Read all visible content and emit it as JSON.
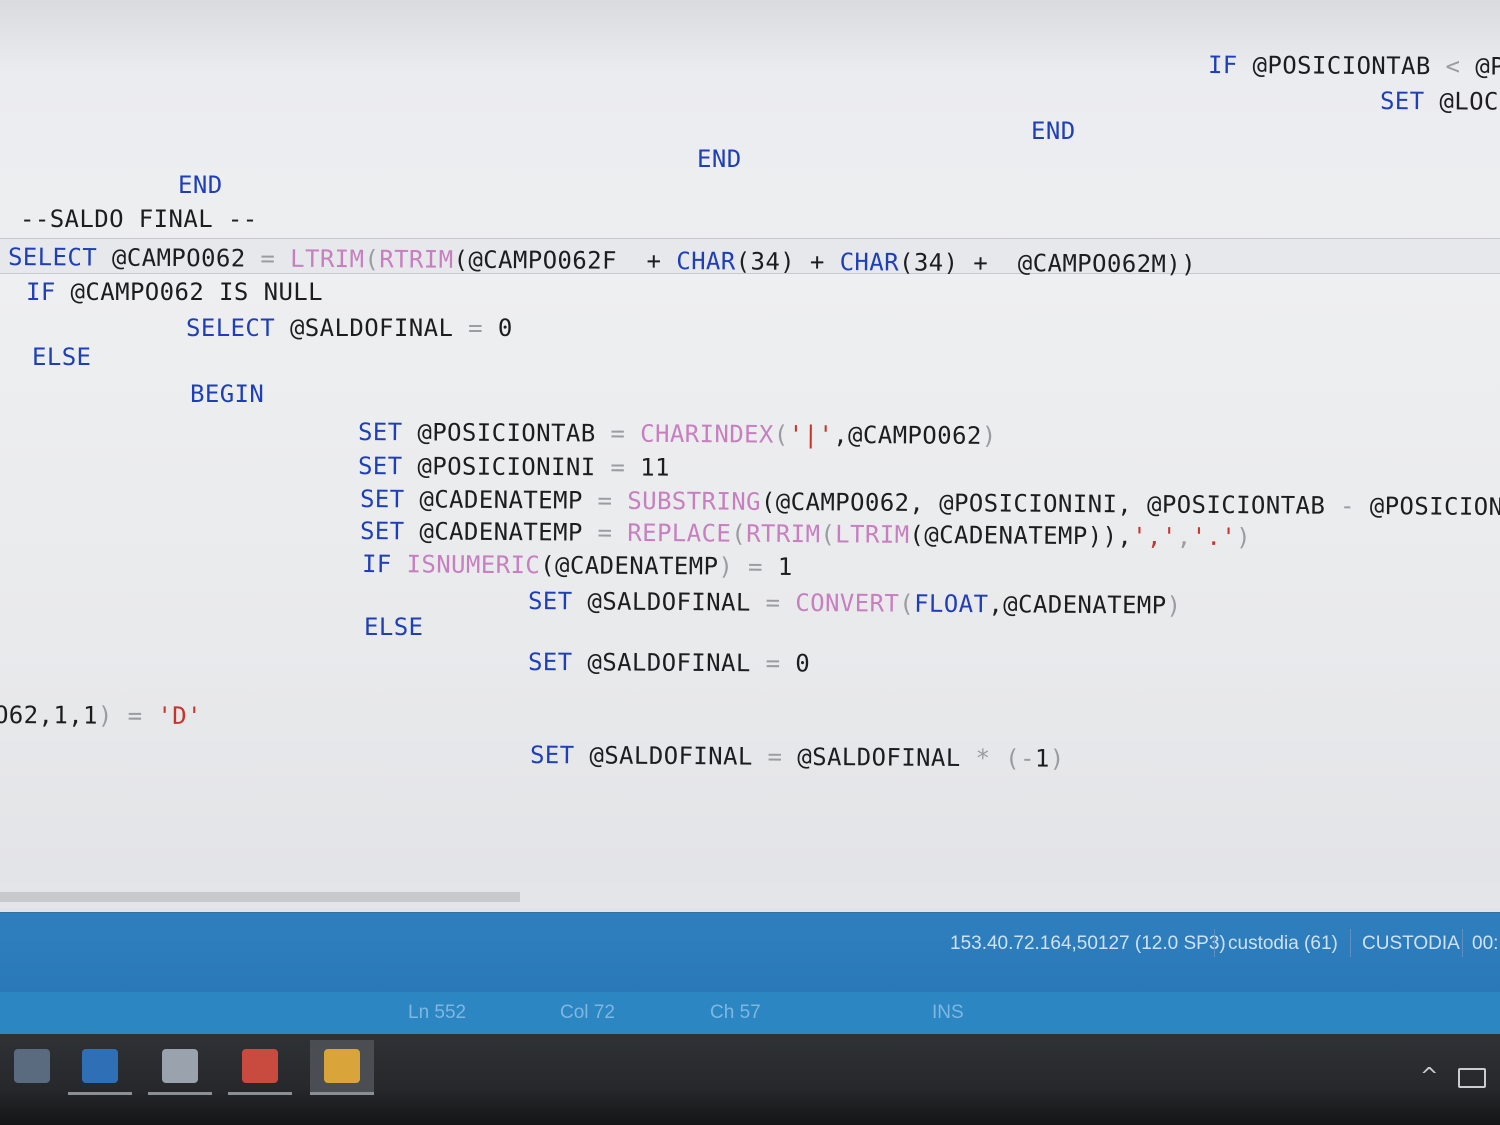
{
  "editor": {
    "lines": [
      {
        "id": "line-if-posiciontab",
        "segments": [
          {
            "text": "IF",
            "cls": "kw"
          },
          {
            "text": " @POSICIONTAB ",
            "cls": "cm"
          },
          {
            "text": "<",
            "cls": "op"
          },
          {
            "text": " @P",
            "cls": "cm"
          }
        ]
      },
      {
        "id": "line-set-loc",
        "segments": [
          {
            "text": "SET",
            "cls": "kw"
          },
          {
            "text": " @LOC",
            "cls": "cm"
          }
        ]
      },
      {
        "id": "line-end-1",
        "segments": [
          {
            "text": "END",
            "cls": "kw"
          }
        ]
      },
      {
        "id": "line-end-2",
        "segments": [
          {
            "text": "END",
            "cls": "kw"
          }
        ]
      },
      {
        "id": "line-end-3",
        "segments": [
          {
            "text": "END",
            "cls": "kw"
          }
        ]
      },
      {
        "id": "line-comment-saldo",
        "segments": [
          {
            "text": "--SALDO FINAL --",
            "cls": "cm"
          }
        ]
      },
      {
        "id": "line-select-campo062",
        "segments": [
          {
            "text": "SELECT",
            "cls": "kw"
          },
          {
            "text": " @CAMPO062 ",
            "cls": "cm"
          },
          {
            "text": "=",
            "cls": "op"
          },
          {
            "text": " ",
            "cls": "cm"
          },
          {
            "text": "LTRIM",
            "cls": "fn"
          },
          {
            "text": "(",
            "cls": "op"
          },
          {
            "text": "RTRIM",
            "cls": "fn"
          },
          {
            "text": "(@CAMPO062F  + ",
            "cls": "cm"
          },
          {
            "text": "CHAR",
            "cls": "kw"
          },
          {
            "text": "(34) + ",
            "cls": "cm"
          },
          {
            "text": "CHAR",
            "cls": "kw"
          },
          {
            "text": "(34) +  @CAMPO062M))",
            "cls": "cm"
          }
        ]
      },
      {
        "id": "line-if-null",
        "segments": [
          {
            "text": "IF",
            "cls": "kw"
          },
          {
            "text": " @CAMPO062 IS NULL",
            "cls": "cm"
          }
        ]
      },
      {
        "id": "line-select-saldofinal",
        "segments": [
          {
            "text": "SELECT",
            "cls": "kw"
          },
          {
            "text": " @SALDOFINAL ",
            "cls": "cm"
          },
          {
            "text": "=",
            "cls": "op"
          },
          {
            "text": " 0",
            "cls": "cm"
          }
        ]
      },
      {
        "id": "line-else-1",
        "segments": [
          {
            "text": "ELSE",
            "cls": "kw"
          }
        ]
      },
      {
        "id": "line-begin",
        "segments": [
          {
            "text": "BEGIN",
            "cls": "kw"
          }
        ]
      },
      {
        "id": "line-set-posiciontab",
        "segments": [
          {
            "text": "SET",
            "cls": "kw"
          },
          {
            "text": " @POSICIONTAB ",
            "cls": "cm"
          },
          {
            "text": "=",
            "cls": "op"
          },
          {
            "text": " ",
            "cls": "cm"
          },
          {
            "text": "CHARINDEX",
            "cls": "fn"
          },
          {
            "text": "(",
            "cls": "op"
          },
          {
            "text": "'|'",
            "cls": "str"
          },
          {
            "text": ",@CAMPO062",
            "cls": "cm"
          },
          {
            "text": ")",
            "cls": "op"
          }
        ]
      },
      {
        "id": "line-set-posicionini",
        "segments": [
          {
            "text": "SET",
            "cls": "kw"
          },
          {
            "text": " @POSICIONINI ",
            "cls": "cm"
          },
          {
            "text": "=",
            "cls": "op"
          },
          {
            "text": " 11",
            "cls": "cm"
          }
        ]
      },
      {
        "id": "line-set-cadenatemp-1",
        "segments": [
          {
            "text": "SET",
            "cls": "kw"
          },
          {
            "text": " @CADENATEMP ",
            "cls": "cm"
          },
          {
            "text": "=",
            "cls": "op"
          },
          {
            "text": " ",
            "cls": "cm"
          },
          {
            "text": "SUBSTRING",
            "cls": "fn"
          },
          {
            "text": "(@CAMPO062, @POSICIONINI, @POSICIONTAB ",
            "cls": "cm"
          },
          {
            "text": "-",
            "cls": "op"
          },
          {
            "text": " @POSICIONINI)",
            "cls": "cm"
          }
        ]
      },
      {
        "id": "line-set-cadenatemp-2",
        "segments": [
          {
            "text": "SET",
            "cls": "kw"
          },
          {
            "text": " @CADENATEMP ",
            "cls": "cm"
          },
          {
            "text": "=",
            "cls": "op"
          },
          {
            "text": " ",
            "cls": "cm"
          },
          {
            "text": "REPLACE",
            "cls": "fn"
          },
          {
            "text": "(",
            "cls": "op"
          },
          {
            "text": "RTRIM",
            "cls": "fn"
          },
          {
            "text": "(",
            "cls": "op"
          },
          {
            "text": "LTRIM",
            "cls": "fn"
          },
          {
            "text": "(@CADENATEMP)),",
            "cls": "cm"
          },
          {
            "text": "','",
            "cls": "str"
          },
          {
            "text": ",",
            "cls": "op"
          },
          {
            "text": "'.'",
            "cls": "str"
          },
          {
            "text": ")",
            "cls": "op"
          }
        ]
      },
      {
        "id": "line-if-isnumeric",
        "segments": [
          {
            "text": "IF",
            "cls": "kw"
          },
          {
            "text": " ",
            "cls": "cm"
          },
          {
            "text": "ISNUMERIC",
            "cls": "fn"
          },
          {
            "text": "(@CADENATEMP",
            "cls": "cm"
          },
          {
            "text": ") =",
            "cls": "op"
          },
          {
            "text": " 1",
            "cls": "cm"
          }
        ]
      },
      {
        "id": "line-set-saldofinal-convert",
        "segments": [
          {
            "text": "SET",
            "cls": "kw"
          },
          {
            "text": " @SALDOFINAL ",
            "cls": "cm"
          },
          {
            "text": "=",
            "cls": "op"
          },
          {
            "text": " ",
            "cls": "cm"
          },
          {
            "text": "CONVERT",
            "cls": "fn"
          },
          {
            "text": "(",
            "cls": "op"
          },
          {
            "text": "FLOAT",
            "cls": "kw"
          },
          {
            "text": ",@CADENATEMP",
            "cls": "cm"
          },
          {
            "text": ")",
            "cls": "op"
          }
        ]
      },
      {
        "id": "line-else-2",
        "segments": [
          {
            "text": "ELSE",
            "cls": "kw"
          }
        ]
      },
      {
        "id": "line-set-saldofinal-zero",
        "segments": [
          {
            "text": "SET",
            "cls": "kw"
          },
          {
            "text": " @SALDOFINAL ",
            "cls": "cm"
          },
          {
            "text": "=",
            "cls": "op"
          },
          {
            "text": " 0",
            "cls": "cm"
          }
        ]
      },
      {
        "id": "line-substring-d",
        "segments": [
          {
            "text": "O62,1,1",
            "cls": "cm"
          },
          {
            "text": ") =",
            "cls": "op"
          },
          {
            "text": " ",
            "cls": "cm"
          },
          {
            "text": "'D'",
            "cls": "str"
          }
        ]
      },
      {
        "id": "line-set-saldofinal-negate",
        "segments": [
          {
            "text": "SET",
            "cls": "kw"
          },
          {
            "text": " @SALDOFINAL ",
            "cls": "cm"
          },
          {
            "text": "=",
            "cls": "op"
          },
          {
            "text": " @SALDOFINAL ",
            "cls": "cm"
          },
          {
            "text": "* (-",
            "cls": "op"
          },
          {
            "text": "1",
            "cls": "cm"
          },
          {
            "text": ")",
            "cls": "op"
          }
        ]
      }
    ]
  },
  "connection_bar": {
    "server": "153.40.72.164,50127 (12.0 SP3)",
    "user": "custodia (61)",
    "database": "CUSTODIA",
    "elapsed": "00:"
  },
  "status_bar": {
    "line": "Ln 552",
    "column": "Col 72",
    "character": "Ch 57",
    "mode": "INS"
  },
  "taskbar": {
    "apps": [
      {
        "name": "file-explorer-icon",
        "color": "#5a6b7f",
        "active": false,
        "running": false
      },
      {
        "name": "outlook-icon",
        "color": "#2f6fb5",
        "active": false,
        "running": true
      },
      {
        "name": "lync-icon",
        "color": "#9aa3ad",
        "active": false,
        "running": true
      },
      {
        "name": "chrome-icon",
        "color": "#c94a3f",
        "active": false,
        "running": true
      },
      {
        "name": "ssms-icon",
        "color": "#d9a53a",
        "active": true,
        "running": true
      }
    ]
  }
}
